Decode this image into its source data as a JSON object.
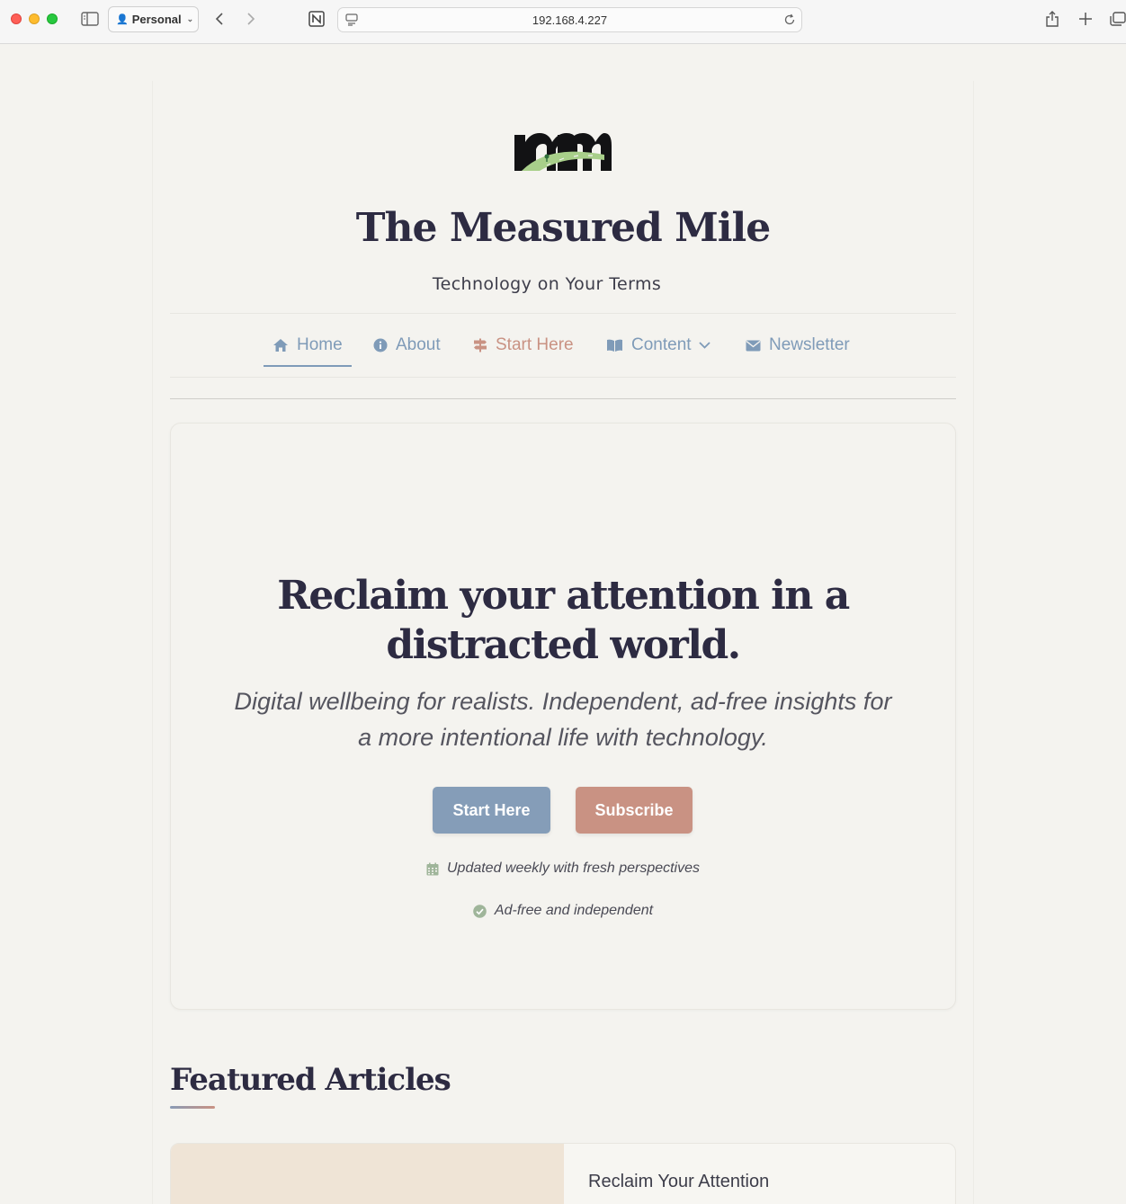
{
  "browser": {
    "profile_label": "Personal",
    "url": "192.168.4.227"
  },
  "site": {
    "title": "The Measured Mile",
    "tagline": "Technology on Your Terms"
  },
  "nav": {
    "home": "Home",
    "about": "About",
    "start_here": "Start Here",
    "content": "Content",
    "newsletter": "Newsletter"
  },
  "hero": {
    "title_line1": "Reclaim your attention in a",
    "title_line2": "distracted world.",
    "subtitle_line1": "Digital wellbeing for realists. Independent, ad-free insights for",
    "subtitle_line2": "a more intentional life with technology.",
    "primary_button": "Start Here",
    "secondary_button": "Subscribe",
    "feature_1": "Updated weekly with fresh perspectives",
    "feature_2": "Ad-free and independent"
  },
  "featured": {
    "section_title": "Featured Articles",
    "articles": [
      {
        "title": "Reclaim Your Attention"
      }
    ]
  },
  "colors": {
    "accent_blue": "#859db8",
    "accent_rose": "#c99283",
    "heading": "#2d2b42",
    "background": "#f4f3ef"
  }
}
